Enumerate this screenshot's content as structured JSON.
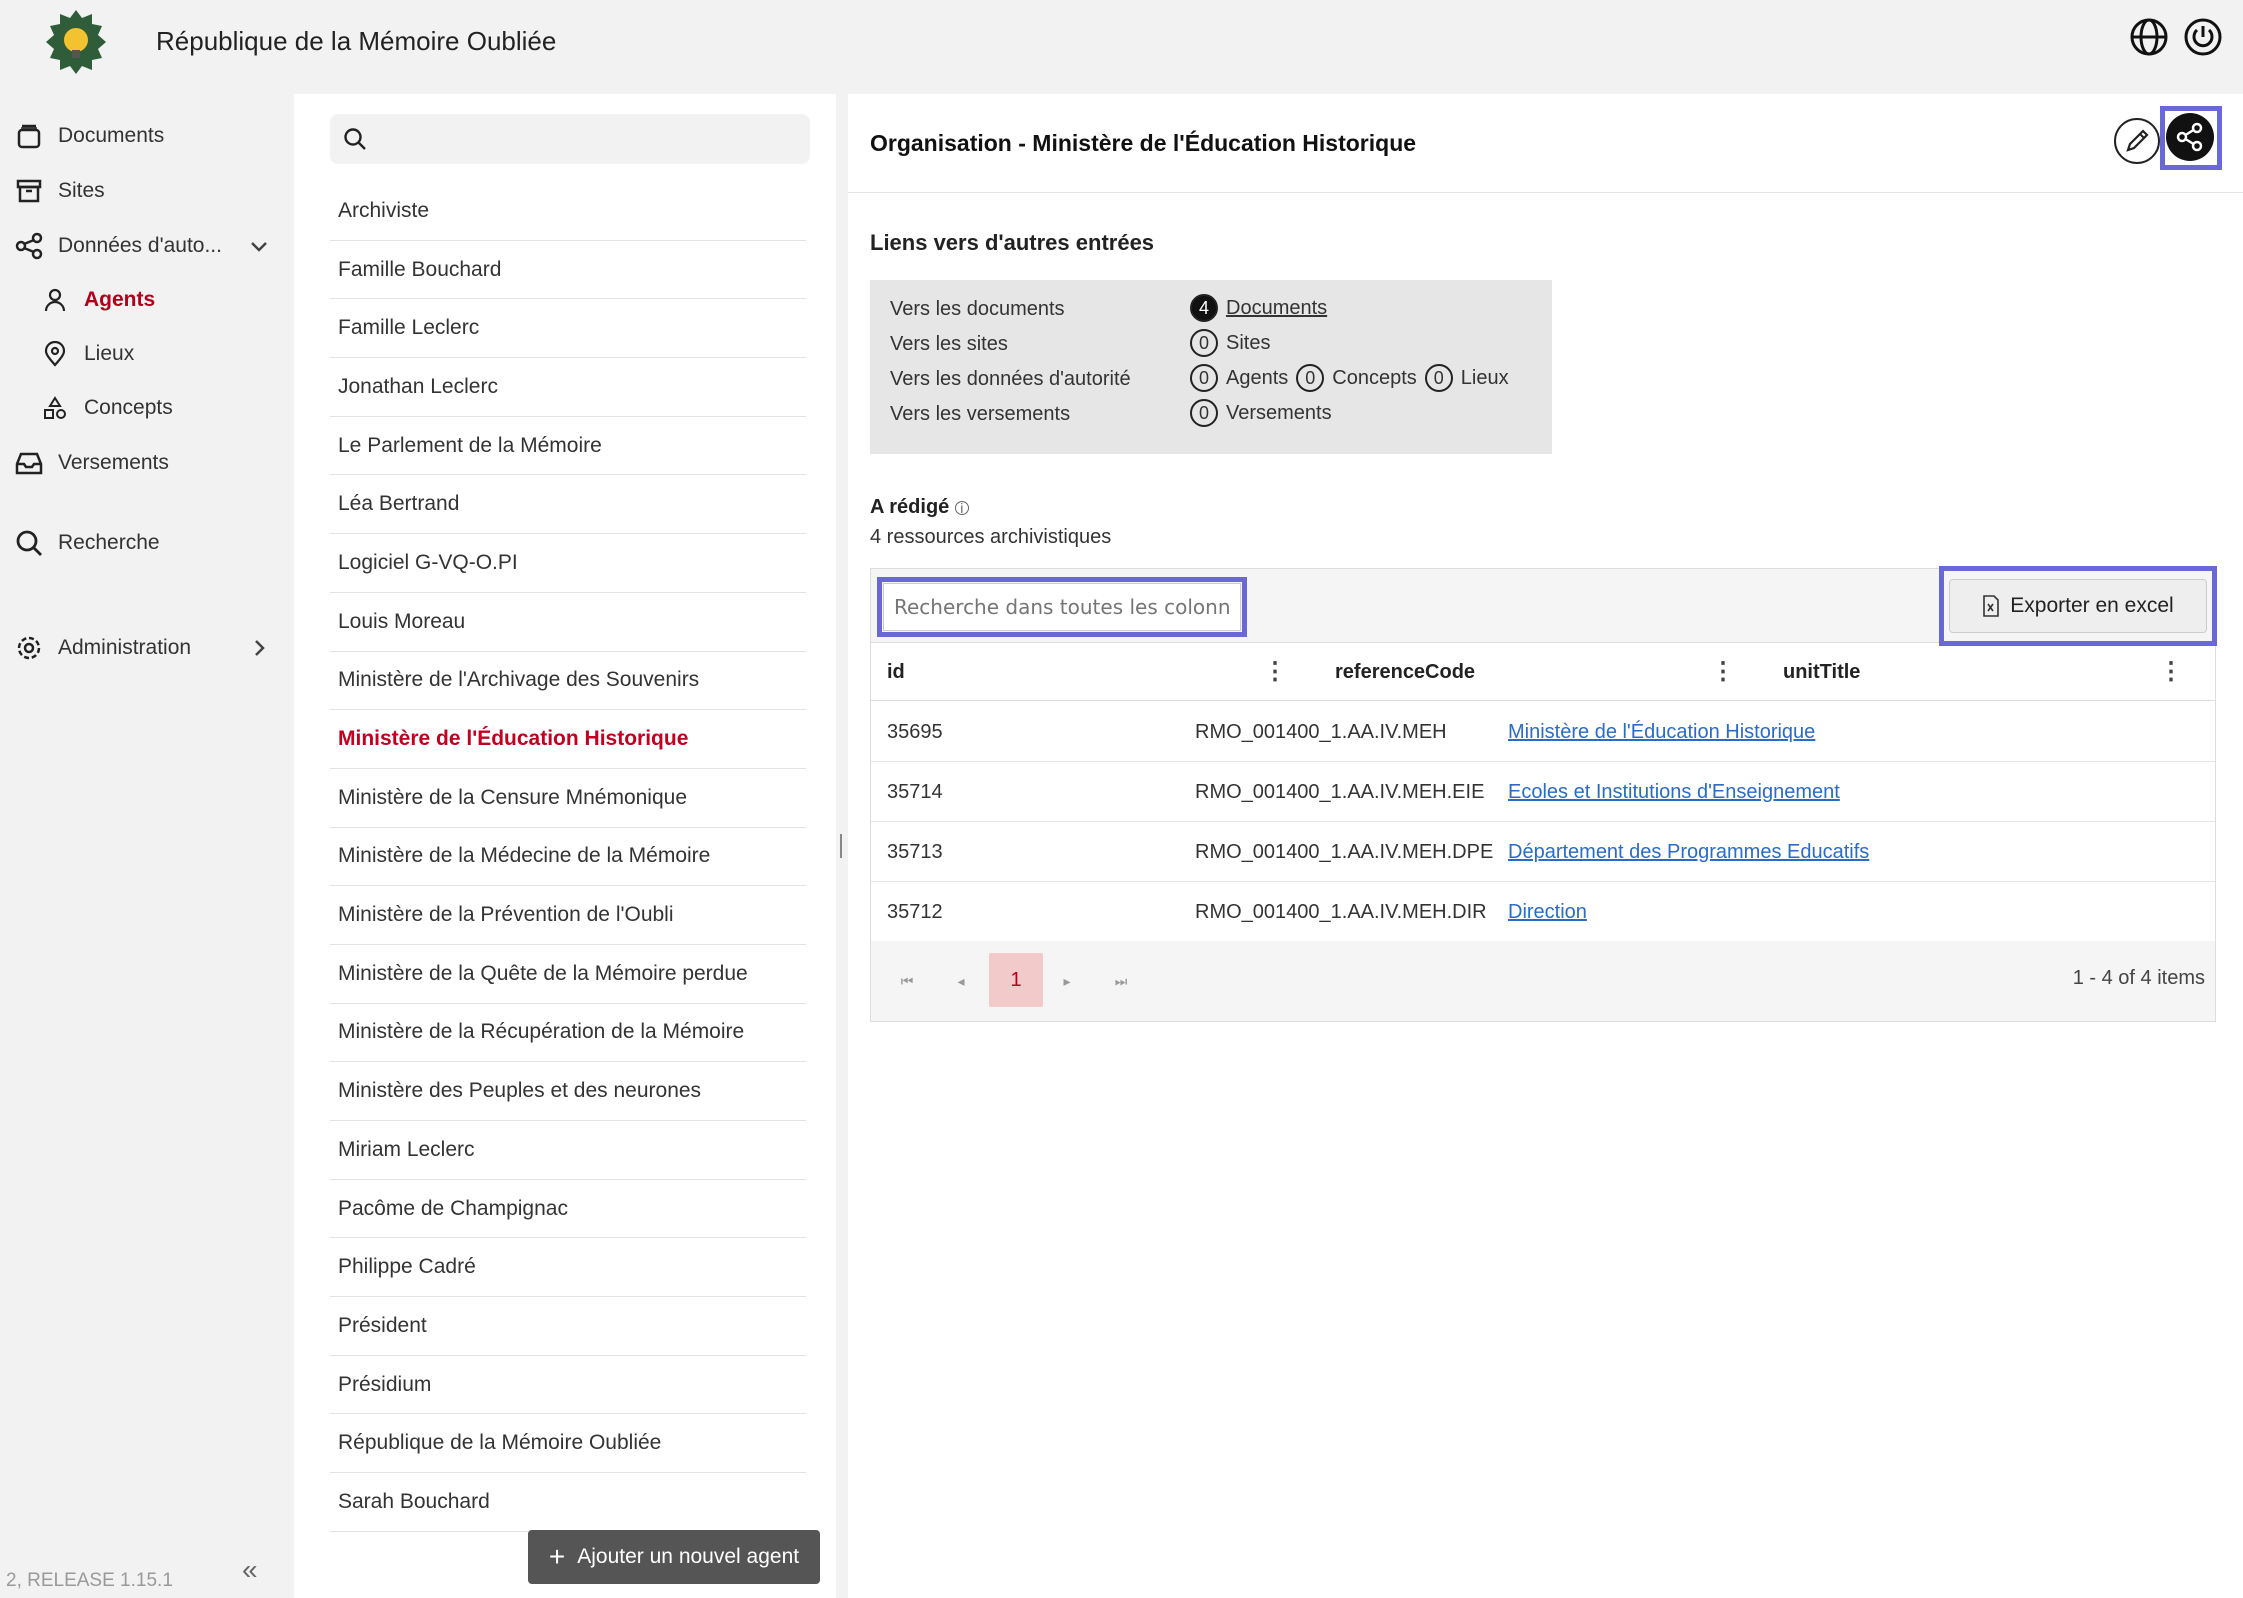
{
  "header": {
    "title": "République de la Mémoire Oubliée",
    "icons": [
      "globe-icon",
      "power-icon"
    ]
  },
  "sidebar": {
    "items": [
      {
        "label": "Documents",
        "icon": "documents-icon"
      },
      {
        "label": "Sites",
        "icon": "archive-box-icon"
      },
      {
        "label": "Données d'auto...",
        "icon": "share-nodes-icon"
      },
      {
        "label": "Agents",
        "icon": "person-icon"
      },
      {
        "label": "Lieux",
        "icon": "pin-icon"
      },
      {
        "label": "Concepts",
        "icon": "shapes-icon"
      },
      {
        "label": "Versements",
        "icon": "inbox-icon"
      },
      {
        "label": "Recherche",
        "icon": "search-icon"
      },
      {
        "label": "Administration",
        "icon": "gear-icon"
      }
    ],
    "version": "2, RELEASE 1.15.1",
    "collapse": "«"
  },
  "list": {
    "items": [
      "Archiviste",
      "Famille Bouchard",
      "Famille Leclerc",
      "Jonathan Leclerc",
      "Le Parlement de la Mémoire",
      "Léa Bertrand",
      "Logiciel G-VQ-O.PI",
      "Louis Moreau",
      "Ministère de l'Archivage des Souvenirs",
      "Ministère de l'Éducation Historique",
      "Ministère de la Censure Mnémonique",
      "Ministère de la Médecine de la Mémoire",
      "Ministère de la Prévention de l'Oubli",
      "Ministère de la Quête de la Mémoire perdue",
      "Ministère de la Récupération de la Mémoire",
      "Ministère des Peuples et des neurones",
      "Miriam Leclerc",
      "Pacôme de Champignac",
      "Philippe Cadré",
      "Président",
      "Présidium",
      "République de la Mémoire Oubliée",
      "Sarah Bouchard"
    ],
    "add_button": "Ajouter un nouvel agent"
  },
  "detail": {
    "title": "Organisation - Ministère de l'Éducation Historique",
    "links_title": "Liens vers d'autres entrées",
    "links": {
      "documents_label": "Vers les documents",
      "documents_count": "4",
      "documents_text": "Documents",
      "sites_label": "Vers les sites",
      "sites_count": "0",
      "sites_text": "Sites",
      "authority_label": "Vers les données d'autorité",
      "agents_count": "0",
      "agents_text": "Agents",
      "concepts_count": "0",
      "concepts_text": "Concepts",
      "lieux_count": "0",
      "lieux_text": "Lieux",
      "versements_label": "Vers les versements",
      "versements_count": "0",
      "versements_text": "Versements"
    },
    "redige_title": "A rédigé",
    "redige_sub": "4 ressources archivistiques",
    "grid": {
      "search_placeholder": "Recherche dans toutes les colonnes",
      "export_label": "Exporter en excel",
      "columns": [
        "id",
        "referenceCode",
        "unitTitle"
      ],
      "rows": [
        {
          "id": "35695",
          "referenceCode": "RMO_001400_1.AA.IV.MEH",
          "unitTitle": "Ministère de l'Éducation Historique"
        },
        {
          "id": "35714",
          "referenceCode": "RMO_001400_1.AA.IV.MEH.EIE",
          "unitTitle": "Ecoles et Institutions d'Enseignement"
        },
        {
          "id": "35713",
          "referenceCode": "RMO_001400_1.AA.IV.MEH.DPE",
          "unitTitle": "Département des Programmes Educatifs"
        },
        {
          "id": "35712",
          "referenceCode": "RMO_001400_1.AA.IV.MEH.DIR",
          "unitTitle": "Direction"
        }
      ],
      "current_page": "1",
      "page_info": "1 - 4 of 4 items"
    }
  },
  "colors": {
    "accent": "#b3001b",
    "highlight": "#6a67d6",
    "link": "#2a6bc8"
  }
}
